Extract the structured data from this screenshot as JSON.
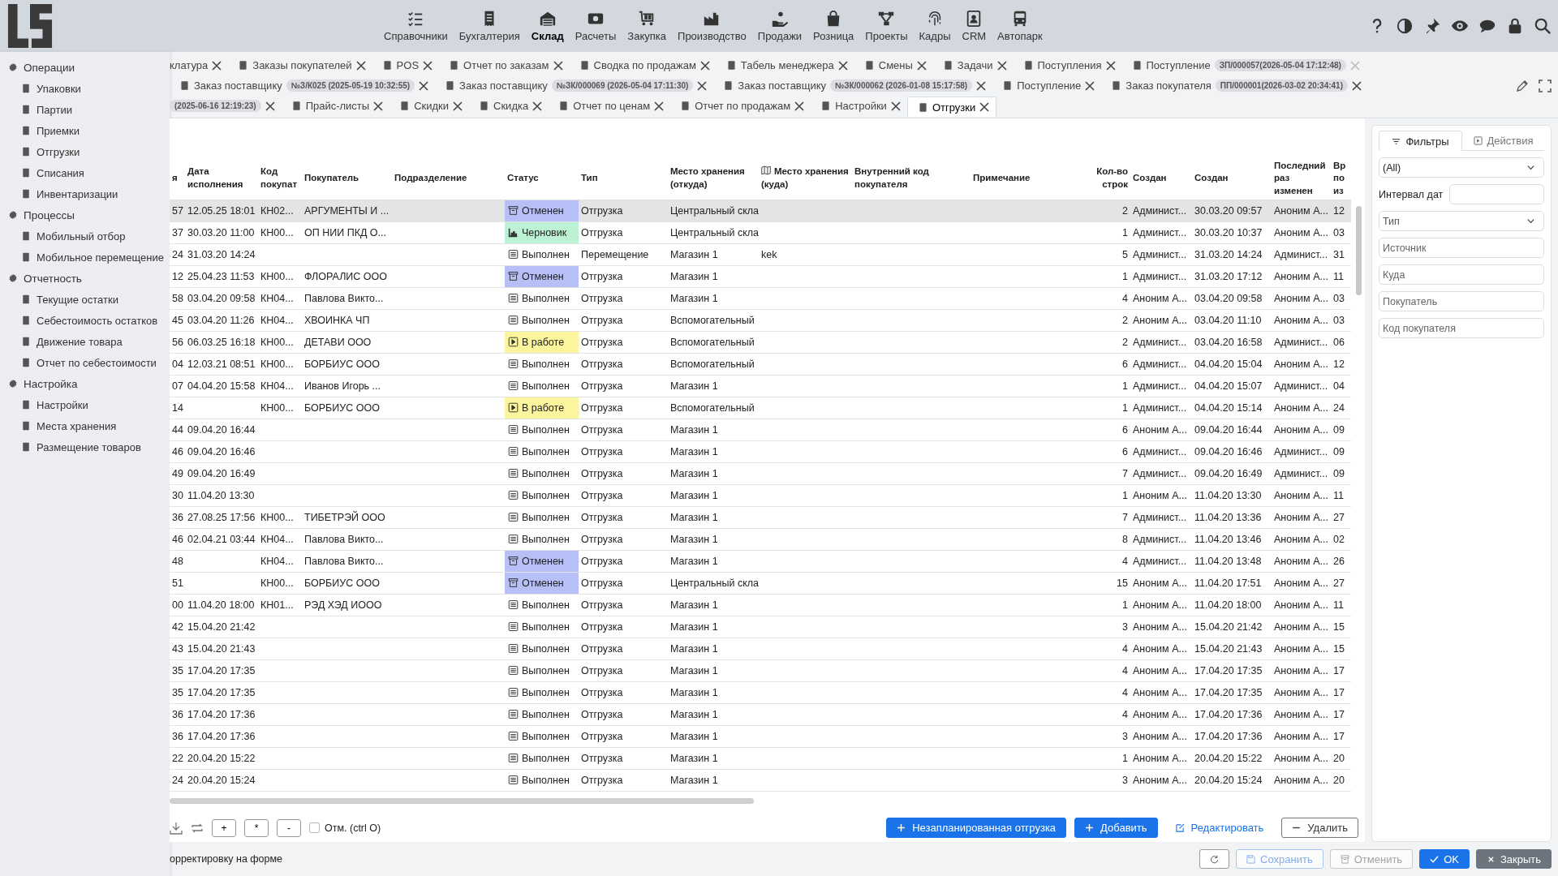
{
  "header": {
    "nav": [
      {
        "label": "Справочники",
        "selected": false
      },
      {
        "label": "Бухгалтерия",
        "selected": false
      },
      {
        "label": "Склад",
        "selected": true
      },
      {
        "label": "Расчеты",
        "selected": false
      },
      {
        "label": "Закупка",
        "selected": false
      },
      {
        "label": "Производство",
        "selected": false
      },
      {
        "label": "Продажи",
        "selected": false
      },
      {
        "label": "Розница",
        "selected": false
      },
      {
        "label": "Проекты",
        "selected": false
      },
      {
        "label": "Кадры",
        "selected": false
      },
      {
        "label": "CRM",
        "selected": false
      },
      {
        "label": "Автопарк",
        "selected": false
      }
    ]
  },
  "menu": [
    {
      "label": "Операции",
      "children": [
        {
          "label": "Упаковки"
        },
        {
          "label": "Партии"
        },
        {
          "label": "Приемки"
        },
        {
          "label": "Отгрузки"
        },
        {
          "label": "Списания"
        },
        {
          "label": "Инвентаризации"
        }
      ]
    },
    {
      "label": "Процессы",
      "children": [
        {
          "label": "Мобильный отбор"
        },
        {
          "label": "Мобильное перемещение"
        }
      ]
    },
    {
      "label": "Отчетность",
      "children": [
        {
          "label": "Текущие остатки"
        },
        {
          "label": "Себестоимость остатков"
        },
        {
          "label": "Движение товара"
        },
        {
          "label": "Отчет по себестоимости"
        }
      ]
    },
    {
      "label": "Настройка",
      "children": [
        {
          "label": "Настройки"
        },
        {
          "label": "Места хранения"
        },
        {
          "label": "Размещение товаров"
        }
      ]
    }
  ],
  "tab_rows": [
    [
      {
        "label": "клатура",
        "clipped": true,
        "selected": false,
        "close_disabled": false
      },
      {
        "label": "Заказы покупателей",
        "clipped": false,
        "selected": false,
        "close_disabled": false
      },
      {
        "label": "POS",
        "clipped": false,
        "selected": false,
        "close_disabled": false
      },
      {
        "label": "Отчет по заказам",
        "clipped": false,
        "selected": false,
        "close_disabled": false
      },
      {
        "label": "Сводка по продажам",
        "clipped": false,
        "selected": false,
        "close_disabled": false
      },
      {
        "label": "Табель менеджера",
        "clipped": false,
        "selected": false,
        "close_disabled": false
      },
      {
        "label": "Смены",
        "clipped": false,
        "selected": false,
        "close_disabled": false
      },
      {
        "label": "Задачи",
        "clipped": false,
        "selected": false,
        "close_disabled": false
      },
      {
        "label": "Поступления",
        "clipped": false,
        "selected": false,
        "close_disabled": false
      },
      {
        "label": "Поступление",
        "badge": "ЗП/000057(2026-05-04 17:12:48)",
        "clipped": false,
        "selected": false,
        "close_disabled": true
      }
    ],
    [
      {
        "label": "Заказ поставщику",
        "badge": "№З/К025 (2025-05-19 10:32:55)",
        "clipped": false,
        "selected": false,
        "close_disabled": false
      },
      {
        "label": "Заказ поставщику",
        "badge": "№ЗК/000069 (2026-05-04 17:11:30)",
        "clipped": false,
        "selected": false,
        "close_disabled": false
      },
      {
        "label": "Заказ поставщику",
        "badge": "№ЗК/000062 (2026-01-08 15:17:58)",
        "clipped": false,
        "selected": false,
        "close_disabled": false
      },
      {
        "label": "Поступление",
        "clipped": false,
        "selected": false,
        "close_disabled": false
      },
      {
        "label": "Заказ покупателя",
        "badge": "ПП/000001(2026-03-02 20:34:41)",
        "clipped": false,
        "selected": false,
        "close_disabled": false
      }
    ],
    [
      {
        "badge": "(2025-06-16 12:19:23)",
        "clipped": true,
        "selected": false,
        "close_disabled": false
      },
      {
        "label": "Прайс-листы",
        "clipped": false,
        "selected": false,
        "close_disabled": false
      },
      {
        "label": "Скидки",
        "clipped": false,
        "selected": false,
        "close_disabled": false
      },
      {
        "label": "Скидка",
        "clipped": false,
        "selected": false,
        "close_disabled": false
      },
      {
        "label": "Отчет по ценам",
        "clipped": false,
        "selected": false,
        "close_disabled": false
      },
      {
        "label": "Отчет по продажам",
        "clipped": false,
        "selected": false,
        "close_disabled": false
      },
      {
        "label": "Настройки",
        "clipped": false,
        "selected": false,
        "close_disabled": false
      },
      {
        "label": "Отгрузки",
        "clipped": false,
        "selected": true,
        "close_disabled": false
      }
    ]
  ],
  "table": {
    "columns": [
      "я",
      "Дата исполнения",
      "Код покупат",
      "Покупатель",
      "Подразделение",
      "Статус",
      "Тип",
      "Место хранения (откуда)",
      "Место хранения (куда)",
      "Внутренний код покупателя",
      "Примечание",
      "Кол-во строк",
      "Создан",
      "Создан",
      "Последний раз изменен",
      "Вр по из"
    ],
    "rows": [
      {
        "col_1": "57",
        "execution_date": "12.05.25 18:01",
        "buyer_code": "КН02...",
        "buyer": "АРГУМЕНТЫ И ...",
        "status": {
          "label": "Отменен",
          "kind": "canceled"
        },
        "type": "Отгрузка",
        "store_from": "Центральный скла",
        "lines": "2",
        "created_by": "Админист...",
        "created_at": "30.03.20 09:57",
        "modified_by": "Аноним А...",
        "col_16": "12",
        "selected": true
      },
      {
        "col_1": "37",
        "execution_date": "30.03.20 11:00",
        "buyer_code": "КН00...",
        "buyer": "ОП НИИ ПКД О...",
        "status": {
          "label": "Черновик",
          "kind": "draft"
        },
        "type": "Отгрузка",
        "store_from": "Центральный скла",
        "lines": "1",
        "created_by": "Админист...",
        "created_at": "30.03.20 10:37",
        "modified_by": "Аноним А...",
        "col_16": "03",
        "selected": false
      },
      {
        "col_1": "24",
        "execution_date": "31.03.20 14:24",
        "status": {
          "label": "Выполнен",
          "kind": "done"
        },
        "type": "Перемещение",
        "store_from": "Магазин 1",
        "store_to": "kek",
        "lines": "5",
        "created_by": "Админист...",
        "created_at": "31.03.20 14:24",
        "modified_by": "Админист...",
        "col_16": "31",
        "selected": false
      },
      {
        "col_1": "12",
        "execution_date": "25.04.23 11:53",
        "buyer_code": "КН00...",
        "buyer": "ФЛОРАЛИС ООО",
        "status": {
          "label": "Отменен",
          "kind": "canceled"
        },
        "type": "Отгрузка",
        "store_from": "Магазин 1",
        "lines": "1",
        "created_by": "Админист...",
        "created_at": "31.03.20 17:12",
        "modified_by": "Аноним А...",
        "col_16": "11",
        "selected": false
      },
      {
        "col_1": "58",
        "execution_date": "03.04.20 09:58",
        "buyer_code": "КН04...",
        "buyer": "Павлова Викто...",
        "status": {
          "label": "Выполнен",
          "kind": "done"
        },
        "type": "Отгрузка",
        "store_from": "Магазин 1",
        "lines": "4",
        "created_by": "Аноним А...",
        "created_at": "03.04.20 09:58",
        "modified_by": "Аноним А...",
        "col_16": "03",
        "selected": false
      },
      {
        "col_1": "45",
        "execution_date": "03.04.20 11:26",
        "buyer_code": "КН04...",
        "buyer": "ХВОИНКА ЧП",
        "status": {
          "label": "Выполнен",
          "kind": "done"
        },
        "type": "Отгрузка",
        "store_from": "Вспомогательный",
        "lines": "2",
        "created_by": "Аноним А...",
        "created_at": "03.04.20 11:10",
        "modified_by": "Аноним А...",
        "col_16": "03",
        "selected": false
      },
      {
        "col_1": "56",
        "execution_date": "06.03.25 16:18",
        "buyer_code": "КН00...",
        "buyer": "ДЕТАВИ ООО",
        "status": {
          "label": "В работе",
          "kind": "in_progress"
        },
        "type": "Отгрузка",
        "store_from": "Вспомогательный",
        "lines": "2",
        "created_by": "Админист...",
        "created_at": "03.04.20 16:58",
        "modified_by": "Админист...",
        "col_16": "06",
        "selected": false
      },
      {
        "col_1": "04",
        "execution_date": "12.03.21 08:51",
        "buyer_code": "КН00...",
        "buyer": "БОРБИУС ООО",
        "status": {
          "label": "Выполнен",
          "kind": "done"
        },
        "type": "Отгрузка",
        "store_from": "Вспомогательный",
        "lines": "6",
        "created_by": "Админист...",
        "created_at": "04.04.20 15:04",
        "modified_by": "Аноним А...",
        "col_16": "12",
        "selected": false
      },
      {
        "col_1": "07",
        "execution_date": "04.04.20 15:58",
        "buyer_code": "КН04...",
        "buyer": "Иванов Игорь ...",
        "status": {
          "label": "Выполнен",
          "kind": "done"
        },
        "type": "Отгрузка",
        "store_from": "Магазин 1",
        "lines": "1",
        "created_by": "Админист...",
        "created_at": "04.04.20 15:07",
        "modified_by": "Админист...",
        "col_16": "04",
        "selected": false
      },
      {
        "col_1": "14",
        "buyer_code": "КН00...",
        "buyer": "БОРБИУС ООО",
        "status": {
          "label": "В работе",
          "kind": "in_progress"
        },
        "type": "Отгрузка",
        "store_from": "Вспомогательный",
        "lines": "1",
        "created_by": "Админист...",
        "created_at": "04.04.20 15:14",
        "modified_by": "Аноним А...",
        "col_16": "24",
        "selected": false
      },
      {
        "col_1": "44",
        "execution_date": "09.04.20 16:44",
        "status": {
          "label": "Выполнен",
          "kind": "done"
        },
        "type": "Отгрузка",
        "store_from": "Магазин 1",
        "lines": "6",
        "created_by": "Аноним А...",
        "created_at": "09.04.20 16:44",
        "modified_by": "Аноним А...",
        "col_16": "09",
        "selected": false
      },
      {
        "col_1": "46",
        "execution_date": "09.04.20 16:46",
        "status": {
          "label": "Выполнен",
          "kind": "done"
        },
        "type": "Отгрузка",
        "store_from": "Магазин 1",
        "lines": "6",
        "created_by": "Админист...",
        "created_at": "09.04.20 16:46",
        "modified_by": "Админист...",
        "col_16": "09",
        "selected": false
      },
      {
        "col_1": "49",
        "execution_date": "09.04.20 16:49",
        "status": {
          "label": "Выполнен",
          "kind": "done"
        },
        "type": "Отгрузка",
        "store_from": "Магазин 1",
        "lines": "7",
        "created_by": "Админист...",
        "created_at": "09.04.20 16:49",
        "modified_by": "Админист...",
        "col_16": "09",
        "selected": false
      },
      {
        "col_1": "30",
        "execution_date": "11.04.20 13:30",
        "status": {
          "label": "Выполнен",
          "kind": "done"
        },
        "type": "Отгрузка",
        "store_from": "Магазин 1",
        "lines": "1",
        "created_by": "Аноним А...",
        "created_at": "11.04.20 13:30",
        "modified_by": "Аноним А...",
        "col_16": "11",
        "selected": false
      },
      {
        "col_1": "36",
        "execution_date": "27.08.25 17:56",
        "buyer_code": "КН00...",
        "buyer": "ТИБЕТРЭЙ ООО",
        "status": {
          "label": "Выполнен",
          "kind": "done"
        },
        "type": "Отгрузка",
        "store_from": "Магазин 1",
        "lines": "7",
        "created_by": "Админист...",
        "created_at": "11.04.20 13:36",
        "modified_by": "Аноним А...",
        "col_16": "27",
        "selected": false
      },
      {
        "col_1": "46",
        "execution_date": "02.04.21 03:44",
        "buyer_code": "КН04...",
        "buyer": "Павлова Викто...",
        "status": {
          "label": "Выполнен",
          "kind": "done"
        },
        "type": "Отгрузка",
        "store_from": "Магазин 1",
        "lines": "8",
        "created_by": "Админист...",
        "created_at": "11.04.20 13:46",
        "modified_by": "Аноним А...",
        "col_16": "02",
        "selected": false
      },
      {
        "col_1": "48",
        "buyer_code": "КН04...",
        "buyer": "Павлова Викто...",
        "status": {
          "label": "Отменен",
          "kind": "canceled"
        },
        "type": "Отгрузка",
        "store_from": "Магазин 1",
        "lines": "4",
        "created_by": "Админист...",
        "created_at": "11.04.20 13:48",
        "modified_by": "Аноним А...",
        "col_16": "26",
        "selected": false
      },
      {
        "col_1": "51",
        "buyer_code": "КН00...",
        "buyer": "БОРБИУС ООО",
        "status": {
          "label": "Отменен",
          "kind": "canceled"
        },
        "type": "Отгрузка",
        "store_from": "Центральный скла",
        "lines": "15",
        "created_by": "Аноним А...",
        "created_at": "11.04.20 17:51",
        "modified_by": "Аноним А...",
        "col_16": "27",
        "selected": false
      },
      {
        "col_1": "00",
        "execution_date": "11.04.20 18:00",
        "buyer_code": "КН01...",
        "buyer": "РЭД ХЭД ИООО",
        "status": {
          "label": "Выполнен",
          "kind": "done"
        },
        "type": "Отгрузка",
        "store_from": "Магазин 1",
        "lines": "1",
        "created_by": "Аноним А...",
        "created_at": "11.04.20 18:00",
        "modified_by": "Аноним А...",
        "col_16": "11",
        "selected": false
      },
      {
        "col_1": "42",
        "execution_date": "15.04.20 21:42",
        "status": {
          "label": "Выполнен",
          "kind": "done"
        },
        "type": "Отгрузка",
        "store_from": "Магазин 1",
        "lines": "3",
        "created_by": "Аноним А...",
        "created_at": "15.04.20 21:42",
        "modified_by": "Аноним А...",
        "col_16": "15",
        "selected": false
      },
      {
        "col_1": "43",
        "execution_date": "15.04.20 21:43",
        "status": {
          "label": "Выполнен",
          "kind": "done"
        },
        "type": "Отгрузка",
        "store_from": "Магазин 1",
        "lines": "4",
        "created_by": "Аноним А...",
        "created_at": "15.04.20 21:43",
        "modified_by": "Аноним А...",
        "col_16": "15",
        "selected": false
      },
      {
        "col_1": "35",
        "execution_date": "17.04.20 17:35",
        "status": {
          "label": "Выполнен",
          "kind": "done"
        },
        "type": "Отгрузка",
        "store_from": "Магазин 1",
        "lines": "4",
        "created_by": "Аноним А...",
        "created_at": "17.04.20 17:35",
        "modified_by": "Аноним А...",
        "col_16": "17",
        "selected": false
      },
      {
        "col_1": "35",
        "execution_date": "17.04.20 17:35",
        "status": {
          "label": "Выполнен",
          "kind": "done"
        },
        "type": "Отгрузка",
        "store_from": "Магазин 1",
        "lines": "4",
        "created_by": "Аноним А...",
        "created_at": "17.04.20 17:35",
        "modified_by": "Аноним А...",
        "col_16": "17",
        "selected": false
      },
      {
        "col_1": "36",
        "execution_date": "17.04.20 17:36",
        "status": {
          "label": "Выполнен",
          "kind": "done"
        },
        "type": "Отгрузка",
        "store_from": "Магазин 1",
        "lines": "4",
        "created_by": "Аноним А...",
        "created_at": "17.04.20 17:36",
        "modified_by": "Аноним А...",
        "col_16": "17",
        "selected": false
      },
      {
        "col_1": "36",
        "execution_date": "17.04.20 17:36",
        "status": {
          "label": "Выполнен",
          "kind": "done"
        },
        "type": "Отгрузка",
        "store_from": "Магазин 1",
        "lines": "3",
        "created_by": "Аноним А...",
        "created_at": "17.04.20 17:36",
        "modified_by": "Аноним А...",
        "col_16": "17",
        "selected": false
      },
      {
        "col_1": "22",
        "execution_date": "20.04.20 15:22",
        "status": {
          "label": "Выполнен",
          "kind": "done"
        },
        "type": "Отгрузка",
        "store_from": "Магазин 1",
        "lines": "1",
        "created_by": "Аноним А...",
        "created_at": "20.04.20 15:22",
        "modified_by": "Аноним А...",
        "col_16": "20",
        "selected": false
      },
      {
        "col_1": "24",
        "execution_date": "20.04.20 15:24",
        "status": {
          "label": "Выполнен",
          "kind": "done"
        },
        "type": "Отгрузка",
        "store_from": "Магазин 1",
        "lines": "3",
        "created_by": "Аноним А...",
        "created_at": "20.04.20 15:24",
        "modified_by": "Аноним А...",
        "col_16": "20",
        "selected": false
      }
    ]
  },
  "toolbar": {
    "small_buttons": [
      "+",
      "*",
      "-"
    ],
    "checkbox": {
      "label": "Отм. (ctrl O)",
      "checked": false
    },
    "actions": [
      {
        "label": "Незапланированная отгрузка",
        "kind": "primary"
      },
      {
        "label": "Добавить",
        "kind": "primary"
      },
      {
        "label": "Редактировать",
        "kind": "link"
      },
      {
        "label": "Удалить",
        "kind": "outline"
      }
    ]
  },
  "filters": {
    "tabs": [
      {
        "label": "Фильтры",
        "selected": true
      },
      {
        "label": "Действия",
        "selected": false
      }
    ],
    "status_select": {
      "value": "(All)"
    },
    "date_range": {
      "label": "Интервал дат"
    },
    "type_select": {
      "placeholder": "Тип"
    },
    "inputs": [
      {
        "placeholder": "Источник"
      },
      {
        "placeholder": "Куда"
      },
      {
        "placeholder": "Покупатель"
      },
      {
        "placeholder": "Код покупателя"
      }
    ]
  },
  "footer": {
    "note": "орректировку на форме",
    "buttons": [
      {
        "label": "Сохранить",
        "kind": "save",
        "disabled": true
      },
      {
        "label": "Отменить",
        "kind": "cancel",
        "disabled": true
      },
      {
        "label": "OK",
        "kind": "ok",
        "disabled": false
      },
      {
        "label": "Закрыть",
        "kind": "close",
        "disabled": false
      }
    ]
  }
}
